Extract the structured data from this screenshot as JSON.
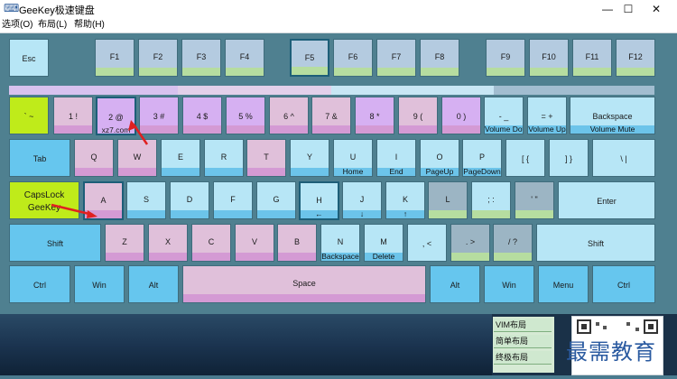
{
  "window": {
    "title": "GeeKey极速键盘",
    "minimize": "—",
    "maximize": "☐",
    "close": "✕"
  },
  "menu": [
    "选项(O)",
    "布局(L)",
    "帮助(H)"
  ],
  "keys": {
    "esc": "Esc",
    "f1": "F1",
    "f2": "F2",
    "f3": "F3",
    "f4": "F4",
    "f5": "F5",
    "f6": "F6",
    "f7": "F7",
    "f8": "F8",
    "f9": "F9",
    "f10": "F10",
    "f11": "F11",
    "f12": "F12",
    "backtick": "` ~",
    "k1": "1 !",
    "k2": "2 @",
    "k2_sub": "xz7.com",
    "k3": "3 #",
    "k4": "4 $",
    "k5": "5 %",
    "k6": "6 ^",
    "k7": "7 &",
    "k8": "8 *",
    "k9": "9 (",
    "k0": "0 )",
    "minus": "- _",
    "minus_sub": "Volume Down",
    "equal": "= +",
    "equal_sub": "Volume Up",
    "backspace": "Backspace",
    "backspace_sub": "Volume Mute",
    "tab": "Tab",
    "q": "Q",
    "w": "W",
    "e": "E",
    "r": "R",
    "t": "T",
    "y": "Y",
    "u": "U",
    "u_sub": "Home",
    "i": "I",
    "i_sub": "End",
    "o": "O",
    "o_sub": "PageUp",
    "p": "P",
    "p_sub": "PageDown",
    "lbracket": "[ {",
    "rbracket": "] }",
    "backslash": "\\ |",
    "caps": "CapsLock",
    "caps_sub": "GeeKey",
    "a": "A",
    "s": "S",
    "d": "D",
    "f": "F",
    "g": "G",
    "h": "H",
    "h_sub": "←",
    "j": "J",
    "j_sub": "↓",
    "k": "K",
    "k_sub": "↑",
    "l": "L",
    "semicolon": "; :",
    "quote": "' \"",
    "enter": "Enter",
    "lshift": "Shift",
    "z": "Z",
    "x": "X",
    "c": "C",
    "v": "V",
    "b": "B",
    "n": "N",
    "n_sub": "Backspace",
    "m": "M",
    "m_sub": "Delete",
    "comma": ", <",
    "period": ". >",
    "slash": "/ ?",
    "rshift": "Shift",
    "lctrl": "Ctrl",
    "lwin": "Win",
    "lalt": "Alt",
    "space": "Space",
    "ralt": "Alt",
    "rwin": "Win",
    "menu": "Menu",
    "rctrl": "Ctrl"
  },
  "layouts": [
    "VIM布局",
    "简单布局",
    "终极布局"
  ],
  "watermark": "最需教育",
  "colors": {
    "lime": "#bfeb1a",
    "lavender": "#d6b0f2",
    "pink": "#e0c0da",
    "sky": "#66c6ee",
    "arrow": "#e02020"
  }
}
